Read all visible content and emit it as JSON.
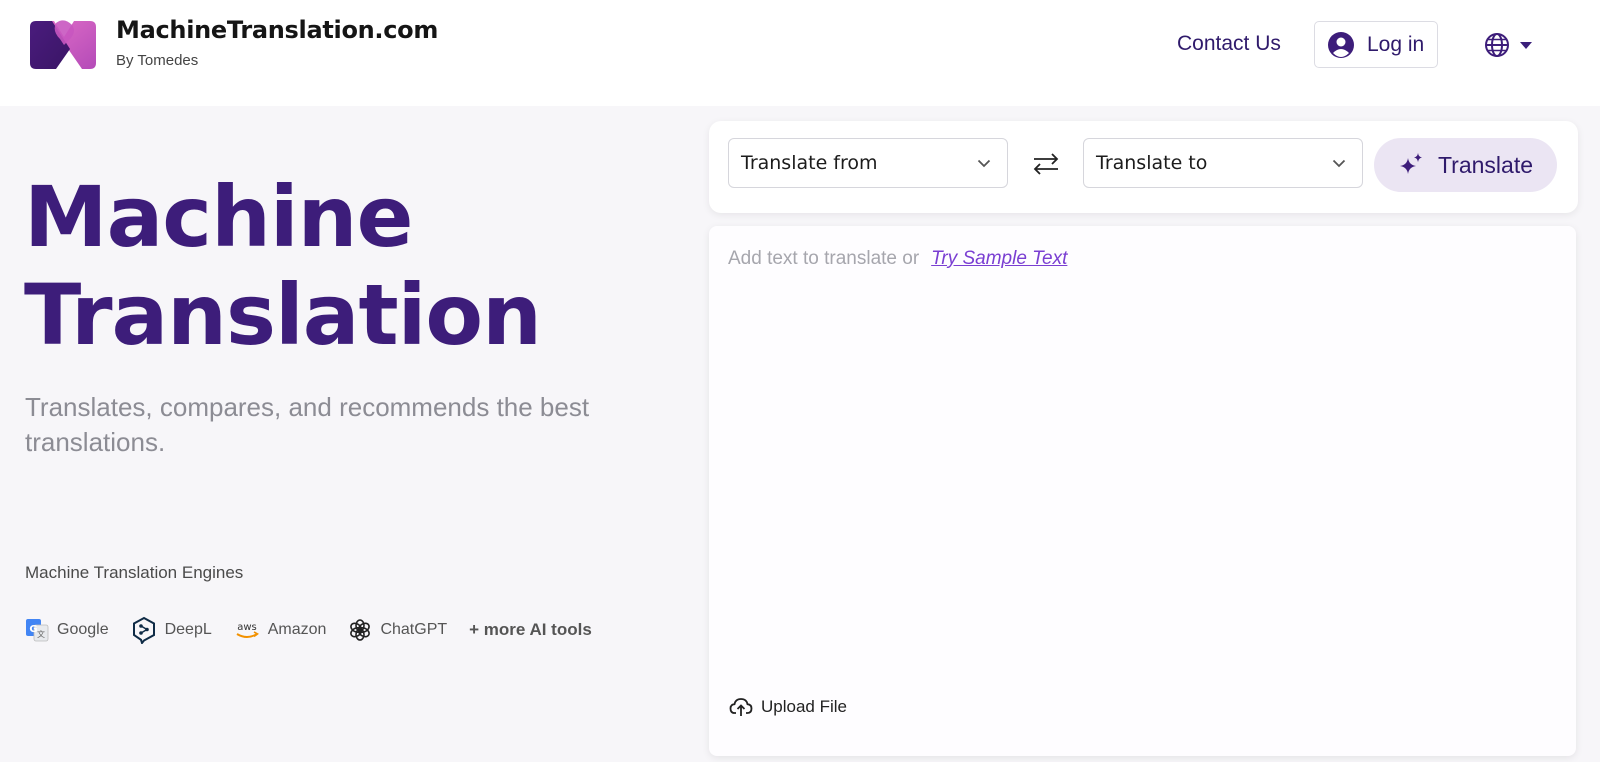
{
  "header": {
    "brand_name": "MachineTranslation.com",
    "brand_sub": "By Tomedes",
    "contact_label": "Contact Us",
    "login_label": "Log in"
  },
  "hero": {
    "title_line1": "Machine",
    "title_line2": "Translation",
    "subtitle": "Translates, compares, and recommends the best translations."
  },
  "engines": {
    "title": "Machine Translation Engines",
    "items": [
      "Google",
      "DeepL",
      "Amazon",
      "ChatGPT"
    ],
    "more_label": "+ more AI tools"
  },
  "translator": {
    "from_label": "Translate from",
    "to_label": "Translate to",
    "translate_label": "Translate",
    "placeholder_prefix": "Add text to translate or",
    "sample_link": "Try Sample Text",
    "upload_label": "Upload File",
    "input_value": ""
  },
  "colors": {
    "brand_purple": "#3d1d7a",
    "link_purple": "#7a3ed2",
    "translate_button_bg": "#ebe5f3",
    "page_bg": "#f7f6f9"
  }
}
